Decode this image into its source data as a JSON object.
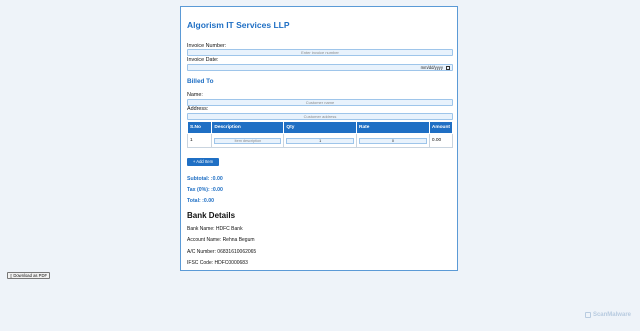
{
  "company_name": "Algorism IT Services LLP",
  "invoice": {
    "number_label": "Invoice Number:",
    "number_placeholder": "Enter invoice number",
    "date_label": "Invoice Date:",
    "date_value": "mm/dd/yyyy"
  },
  "billed_to": {
    "title": "Billed To",
    "name_label": "Name:",
    "name_placeholder": "Customer name",
    "address_label": "Address:",
    "address_placeholder": "Customer address"
  },
  "table": {
    "headers": [
      "S.No",
      "Description",
      "Qty",
      "Rate",
      "Amount"
    ],
    "rows": [
      {
        "sno": "1",
        "description_placeholder": "Item description",
        "qty": "1",
        "rate": "0",
        "amount": "0.00"
      }
    ]
  },
  "add_item_label": "+ Add Item",
  "totals": {
    "subtotal": "Subtotal: :0.00",
    "tax": "Tax (0%): :0.00",
    "total": "Total: :0.00"
  },
  "bank": {
    "title": "Bank Details",
    "bank_name": "Bank Name: HDFC Bank",
    "account_name": "Account Name: Rehna Begum",
    "ac_number": "A/C Number: 06831610062065",
    "ifsc": "IFSC Code: HDFC0000683"
  },
  "download_pdf_label": "Download as PDF",
  "watermark_text": "ScanMalware",
  "colors": {
    "accent": "#1f6fc4",
    "input_bg": "#e8f2fc",
    "page_bg": "#eef3f9"
  }
}
